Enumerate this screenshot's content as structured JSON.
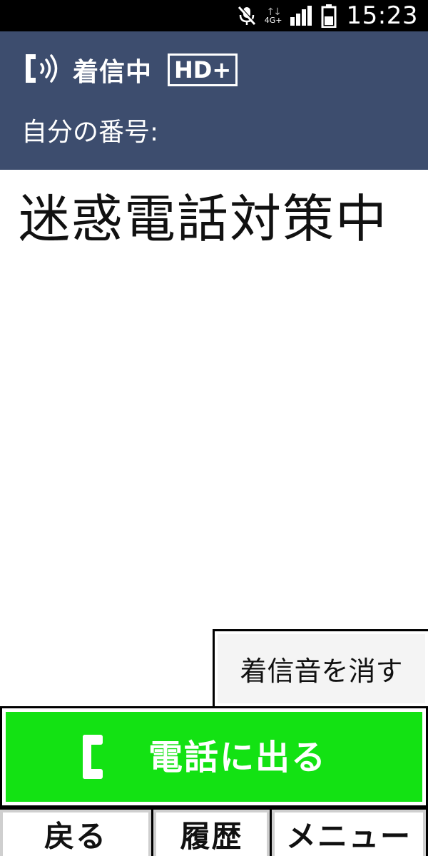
{
  "status_bar": {
    "network_label": "4G+",
    "clock": "15:23",
    "icons": [
      "mic-muted-icon",
      "data-arrows-icon",
      "signal-icon",
      "battery-icon"
    ]
  },
  "header": {
    "state_label": "着信中",
    "hd_badge": "HD+",
    "own_number_label": "自分の番号:"
  },
  "caller": {
    "display_text": "迷惑電話対策中"
  },
  "buttons": {
    "silence_label": "着信音を消す",
    "answer_label": "電話に出る"
  },
  "softkeys": {
    "back": "戻る",
    "history": "履歴",
    "menu": "メニュー"
  },
  "colors": {
    "header_bg": "#3d4d6e",
    "answer_bg": "#13e213",
    "status_bg": "#000000"
  }
}
